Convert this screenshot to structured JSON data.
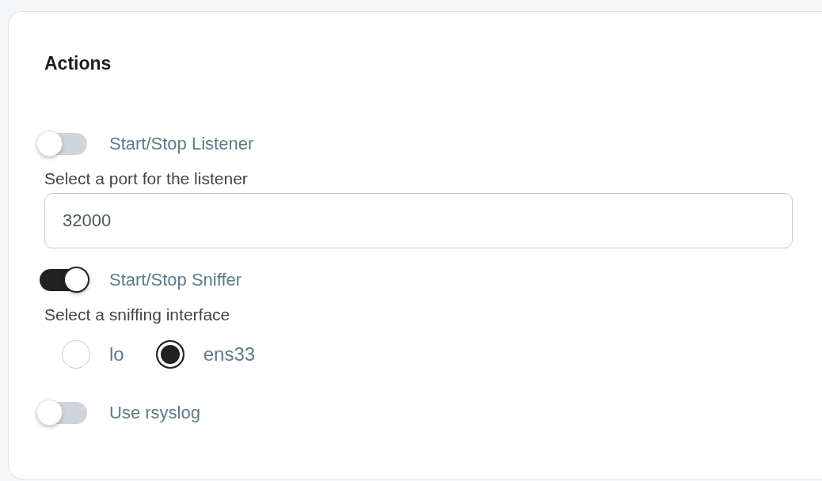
{
  "card": {
    "title": "Actions"
  },
  "items": [
    {
      "kind": "switch",
      "label": "Start/Stop Listener",
      "on": false
    },
    {
      "kind": "field",
      "label": "Select a port for the listener",
      "value": "32000"
    },
    {
      "kind": "switch",
      "label": "Start/Stop Sniffer",
      "on": true
    },
    {
      "kind": "radios",
      "label": "Select a sniffing interface",
      "options": [
        {
          "label": "lo",
          "selected": false
        },
        {
          "label": "ens33",
          "selected": true
        }
      ]
    },
    {
      "kind": "switch",
      "label": "Use rsyslog",
      "on": false
    }
  ]
}
